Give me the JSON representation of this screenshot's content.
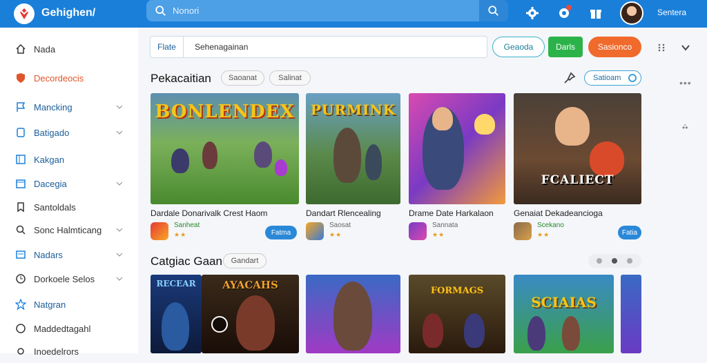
{
  "topbar": {
    "brand": "Gehighen/",
    "search_placeholder": "Nonori"
  },
  "sidebar": {
    "items": [
      {
        "label": "Nada",
        "icon": "home-icon"
      },
      {
        "label": "Decordeocis",
        "icon": "shield-icon"
      },
      {
        "label": "Mancking",
        "icon": "flag-icon"
      },
      {
        "label": "Batigado",
        "icon": "pin-icon"
      },
      {
        "label": "Kakgan",
        "icon": "book-icon"
      },
      {
        "label": "Dacegia",
        "icon": "calendar-icon"
      },
      {
        "label": "Santoldals",
        "icon": "bookmark-icon"
      },
      {
        "label": "Sonc Halmticang",
        "icon": "search-icon"
      },
      {
        "label": "Nadars",
        "icon": "list-icon"
      },
      {
        "label": "Dorkoele Selos",
        "icon": "clock-icon"
      },
      {
        "label": "Natgran",
        "icon": "star-icon"
      },
      {
        "label": "Maddedtagahl",
        "icon": "circle-icon"
      },
      {
        "label": "Inoedelrors",
        "icon": "settings-icon"
      }
    ]
  },
  "filter": {
    "label": "Flate",
    "value": "Sehenagainan",
    "btn_outline": "Geaoda",
    "btn_green": "Darls",
    "btn_orange": "Sasionco"
  },
  "section1": {
    "title": "Pekacaitian",
    "chip1": "Saoanat",
    "chip2": "Salinat",
    "sort": "Satioam"
  },
  "cards": [
    {
      "title_art": "BONLENDEX",
      "name": "Dardale Donarivalk Crest Haom",
      "dev": "Sanheat",
      "stars": "★★",
      "get": "Fatma"
    },
    {
      "title_art": "PURMINK",
      "name": "Dandart Rlencealing",
      "dev": "Saosat",
      "stars": "★★",
      "get": ""
    },
    {
      "title_art": "",
      "name": "Drame Date Harkalaon",
      "dev": "Sannata",
      "stars": "★★",
      "get": ""
    },
    {
      "title_art": "FCALIECT",
      "name": "Genaiat Dekadeancioga",
      "dev": "Scekano",
      "stars": "★★",
      "get": "Fatia"
    }
  ],
  "section2": {
    "title": "Catgiac Gaan",
    "chip": "Gandart"
  },
  "row2": [
    {
      "title_art": "RECEAR"
    },
    {
      "title_art": "AYACAHS"
    },
    {
      "title_art": ""
    },
    {
      "title_art": "FORMAGS"
    },
    {
      "title_art": "SCIAIAS"
    }
  ],
  "user": {
    "name": "Sentera"
  }
}
